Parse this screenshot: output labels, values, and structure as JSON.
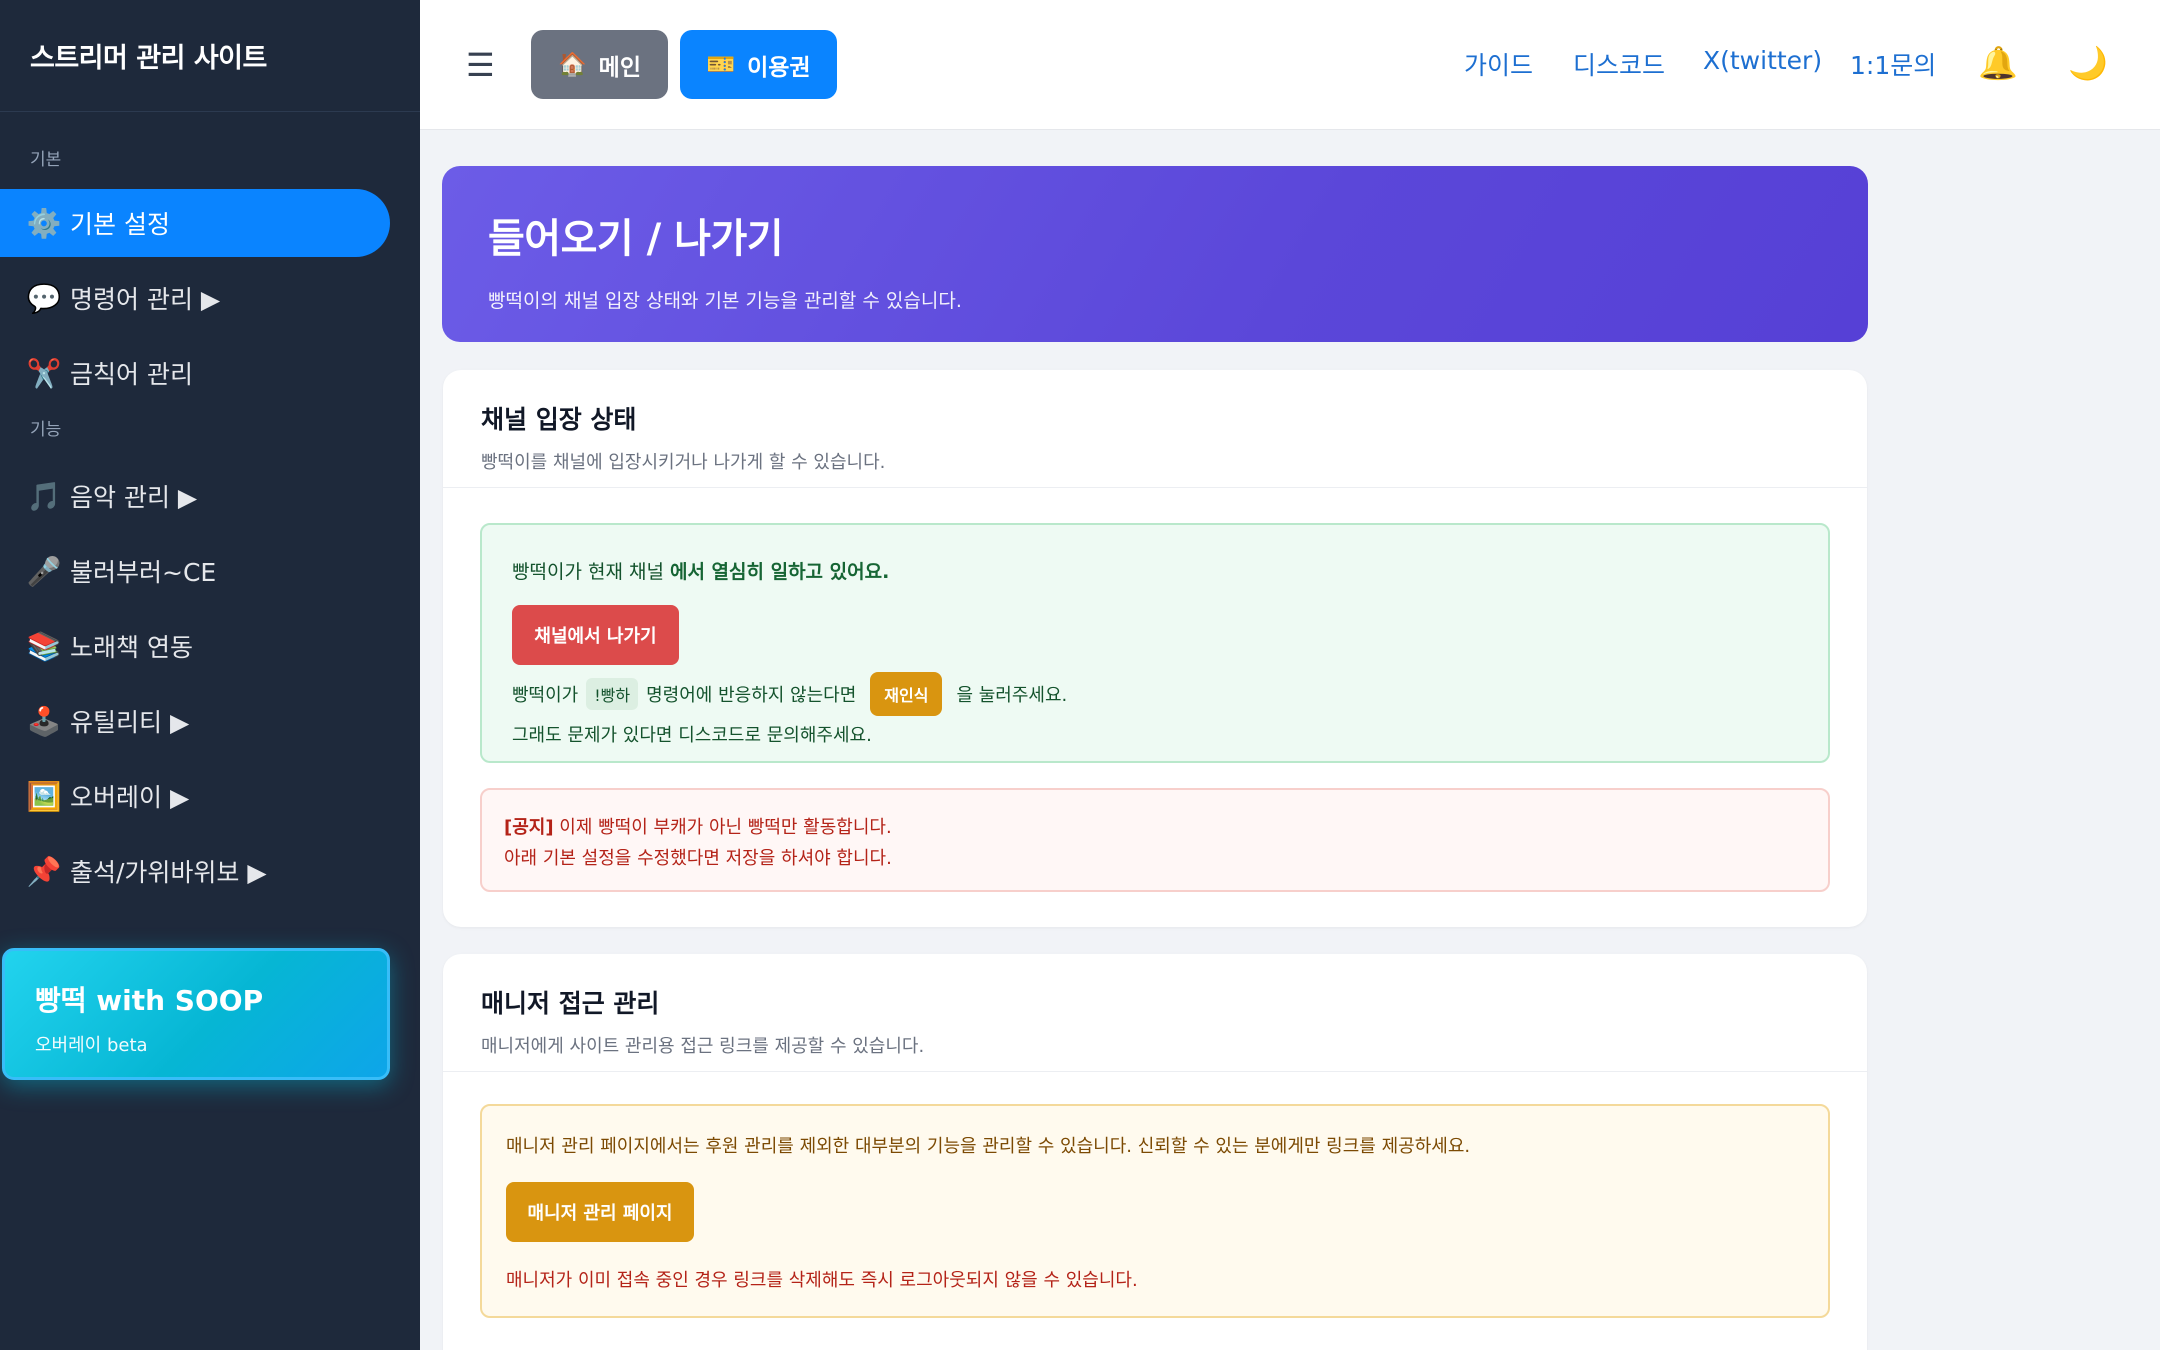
{
  "sidebar": {
    "brand": "스트리머 관리 사이트",
    "section_basic": "기본",
    "section_func": "기능",
    "items": [
      {
        "icon": "⚙️",
        "label": "기본 설정"
      },
      {
        "icon": "💬",
        "label": "명령어 관리 ▶"
      },
      {
        "icon": "✂️",
        "label": "금칙어 관리"
      },
      {
        "icon": "🎵",
        "label": "음악 관리 ▶"
      },
      {
        "icon": "🎤",
        "label": "불러부러~CE"
      },
      {
        "icon": "📚",
        "label": "노래책 연동"
      },
      {
        "icon": "🕹️",
        "label": "유틸리티 ▶"
      },
      {
        "icon": "🖼️",
        "label": "오버레이 ▶"
      },
      {
        "icon": "📌",
        "label": "출석/가위바위보 ▶"
      }
    ],
    "promo": {
      "title": "빵떡 with SOOP",
      "subtitle": "오버레이 beta"
    }
  },
  "topbar": {
    "menu_icon": "☰",
    "main_btn": {
      "icon": "🏠",
      "label": "메인"
    },
    "ticket_btn": {
      "icon": "🎫",
      "label": "이용권"
    },
    "links": [
      "가이드",
      "디스코드",
      "X(twitter)",
      "1:1문의"
    ],
    "bell_icon": "🔔",
    "moon_icon": "🌙"
  },
  "hero": {
    "title": "들어오기 / 나가기",
    "subtitle": "빵떡이의 채널 입장 상태와 기본 기능을 관리할 수 있습니다."
  },
  "channel_card": {
    "title": "채널 입장 상태",
    "subtitle": "빵떡이를 채널에 입장시키거나 나가게 할 수 있습니다.",
    "status_prefix": "빵떡이가 현재 채널 ",
    "status_bold": "에서 열심히 일하고 있어요.",
    "leave_button": "채널에서 나가기",
    "hint_prefix": "빵떡이가",
    "hint_command": "!빵하",
    "hint_middle": "명령어에 반응하지 않는다면",
    "reset_button": "재인식",
    "hint_suffix": "을 눌러주세요.",
    "hint_line2": "그래도 문제가 있다면 디스코드로 문의해주세요.",
    "notice_tag": "[공지]",
    "notice_line1": " 이제 빵떡이 부캐가 아닌 빵떡만 활동합니다.",
    "notice_line2": "아래 기본 설정을 수정했다면 저장을 하셔야 합니다."
  },
  "manager_card": {
    "title": "매니저 접근 관리",
    "subtitle": "매니저에게 사이트 관리용 접근 링크를 제공할 수 있습니다.",
    "info": "매니저 관리 페이지에서는 후원 관리를 제외한 대부분의 기능을 관리할 수 있습니다. 신뢰할 수 있는 분에게만 링크를 제공하세요.",
    "button": "매니저 관리 페이지",
    "footnote": "매니저가 이미 접속 중인 경우 링크를 삭제해도 즉시 로그아웃되지 않을 수 있습니다."
  }
}
